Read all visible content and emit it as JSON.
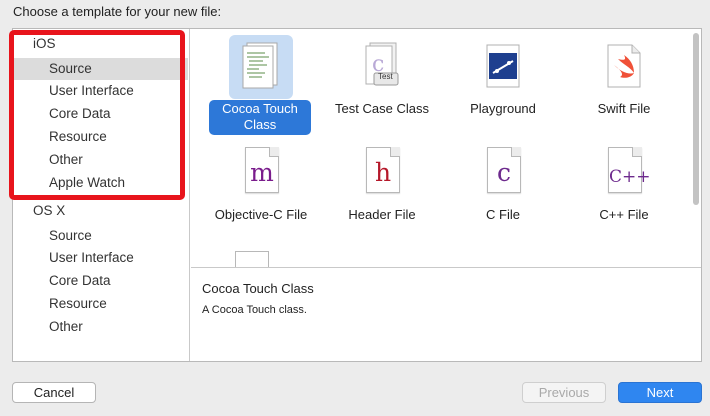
{
  "prompt": "Choose a template for your new file:",
  "sidebar": {
    "platforms": [
      {
        "name": "iOS",
        "categories": [
          "Source",
          "User Interface",
          "Core Data",
          "Resource",
          "Other",
          "Apple Watch"
        ],
        "selected": "Source"
      },
      {
        "name": "OS X",
        "categories": [
          "Source",
          "User Interface",
          "Core Data",
          "Resource",
          "Other"
        ]
      }
    ]
  },
  "templates": [
    {
      "label": "Cocoa Touch Class",
      "icon": "cocoa-touch-class-icon",
      "selected": true
    },
    {
      "label": "Test Case Class",
      "icon": "test-case-icon",
      "badge": "Test"
    },
    {
      "label": "Playground",
      "icon": "playground-icon"
    },
    {
      "label": "Swift File",
      "icon": "swift-icon"
    },
    {
      "label": "Objective-C File",
      "icon": "m-file-icon",
      "glyph": "m",
      "color": "#7a1c8c"
    },
    {
      "label": "Header File",
      "icon": "h-file-icon",
      "glyph": "h",
      "color": "#b5182a"
    },
    {
      "label": "C File",
      "icon": "c-file-icon",
      "glyph": "c",
      "color": "#6d2a8d"
    },
    {
      "label": "C++ File",
      "icon": "cpp-file-icon",
      "glyph": "C++",
      "color": "#6d2a8d"
    }
  ],
  "description": {
    "title": "Cocoa Touch Class",
    "text": "A Cocoa Touch class."
  },
  "buttons": {
    "cancel": "Cancel",
    "previous": "Previous",
    "next": "Next"
  },
  "colors": {
    "accent": "#2f86f0",
    "selection": "#2d78d8",
    "highlight_box": "#e8141c"
  }
}
